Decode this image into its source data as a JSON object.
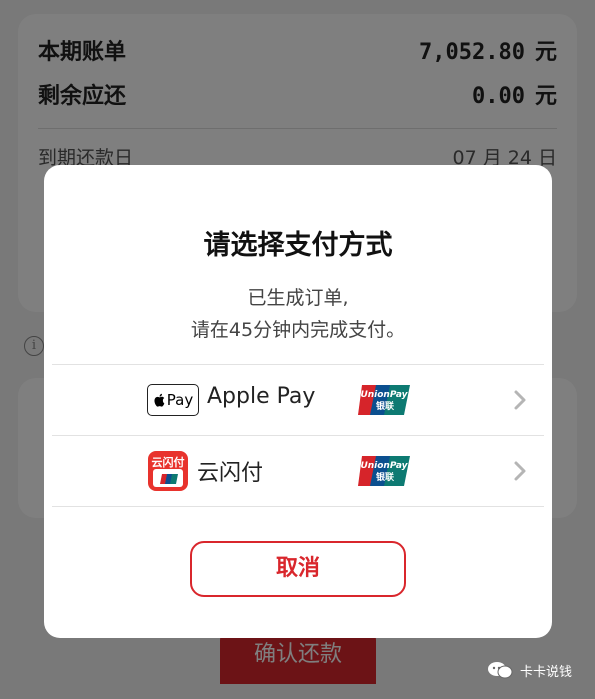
{
  "bill": {
    "current_label": "本期账单",
    "current_amount": "7,052.80",
    "current_unit": "元",
    "remaining_label": "剩余应还",
    "remaining_amount": "0.00",
    "remaining_unit": "元",
    "due_label": "到期还款日",
    "due_date": "07 月 24 日"
  },
  "repay": {
    "confirm_label": "确认还款"
  },
  "watermark": {
    "text": "卡卡说钱"
  },
  "dialog": {
    "title": "请选择支付方式",
    "message_line1": "已生成订单,",
    "message_line2": "请在45分钟内完成支付。",
    "options": [
      {
        "label": "Apple Pay",
        "badge_text": "Pay",
        "icon": "apple-pay-icon",
        "network": "UnionPay",
        "network_cn": "银联"
      },
      {
        "label": "云闪付",
        "badge_text": "云闪付",
        "icon": "yunshanfu-icon",
        "network": "UnionPay",
        "network_cn": "银联"
      }
    ],
    "cancel_label": "取消"
  },
  "colors": {
    "accent_red": "#d9262c",
    "unionpay_red": "#d6242a",
    "unionpay_blue": "#0b4f8f",
    "unionpay_green": "#0d7a72"
  }
}
